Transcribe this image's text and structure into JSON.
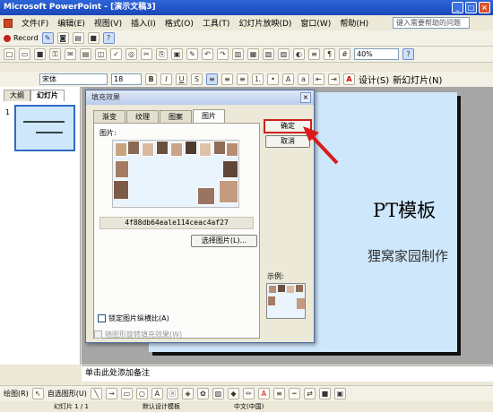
{
  "window": {
    "title": "Microsoft PowerPoint - [演示文稿3]"
  },
  "menu": {
    "items": [
      "文件(F)",
      "编辑(E)",
      "视图(V)",
      "插入(I)",
      "格式(O)",
      "工具(T)",
      "幻灯片放映(D)",
      "窗口(W)",
      "帮助(H)"
    ],
    "help_placeholder": "键入需要帮助的问题"
  },
  "toolbar1": {
    "record_label": "Record"
  },
  "toolbar2": {
    "zoom": "40%"
  },
  "toolbar3": {
    "font_name": "宋体",
    "font_size": "18",
    "design_label": "设计(S)",
    "new_slide_label": "新幻灯片(N)"
  },
  "left_pane": {
    "tabs": [
      "大纲",
      "幻灯片"
    ],
    "slide_number": "1"
  },
  "slide": {
    "title": "PT模板",
    "subtitle": "狸窝家园制作"
  },
  "notes": {
    "placeholder": "单击此处添加备注"
  },
  "drawbar": {
    "draw_label": "绘图(R)",
    "autoshape_label": "自选图形(U)"
  },
  "status": {
    "slide_info": "幻灯片 1 / 1",
    "design": "默认设计模板",
    "lang": "中文(中国)"
  },
  "dialog": {
    "title": "填充效果",
    "tabs": [
      "渐变",
      "纹理",
      "图案",
      "图片"
    ],
    "active_tab": "图片",
    "picture_label": "图片:",
    "picture_name": "4f88db64eale114ceac4af27",
    "choose_label": "选择图片(L)...",
    "lock_label": "锁定图片纵横比(A)",
    "rotate_label": "随图形旋转填充效果(W)",
    "ok_label": "确定",
    "cancel_label": "取消",
    "sample_label": "示例:"
  }
}
